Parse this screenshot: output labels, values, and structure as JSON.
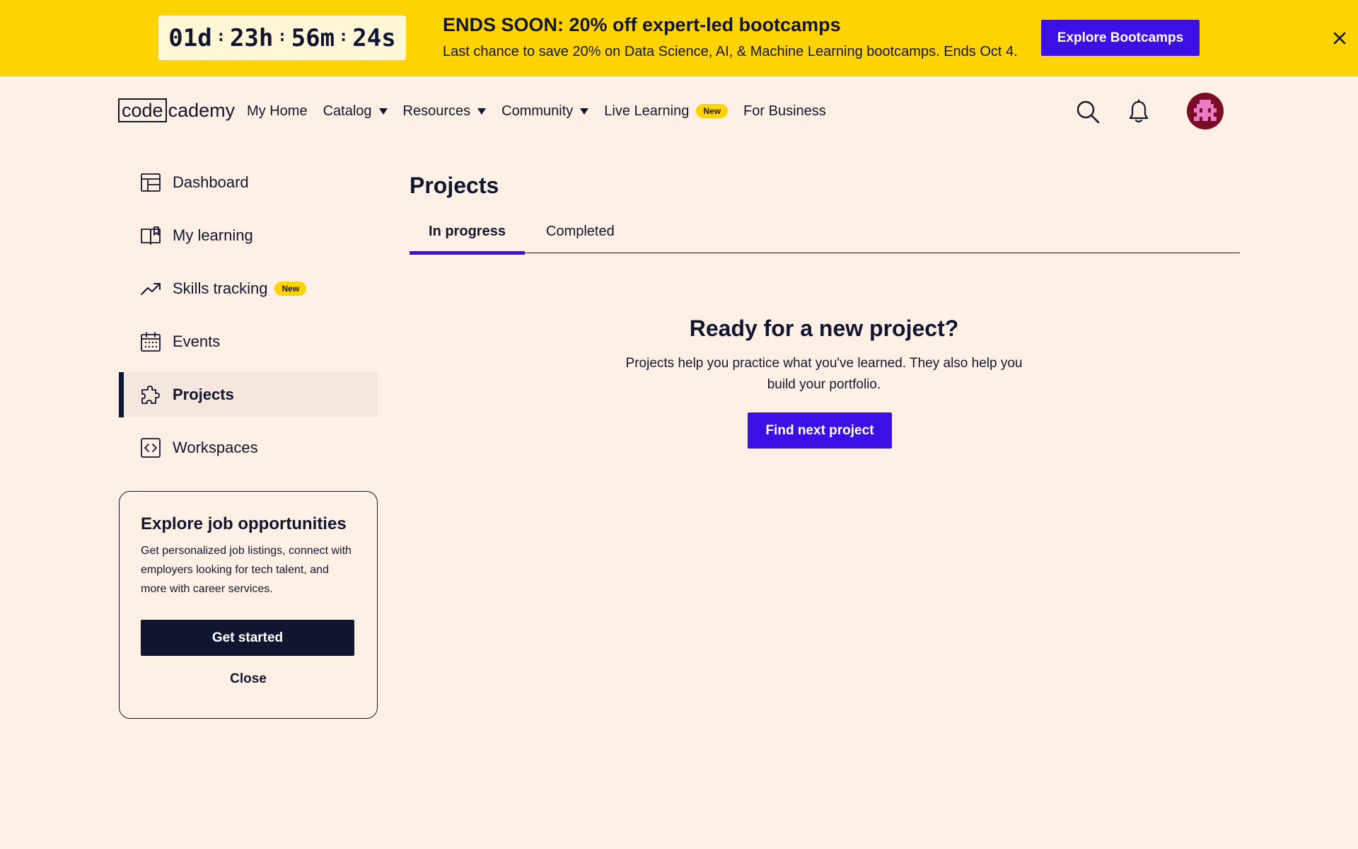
{
  "banner": {
    "countdown": {
      "days": "01d",
      "hours": "23h",
      "minutes": "56m",
      "seconds": "24s",
      "separator": ":"
    },
    "title": "ENDS SOON: 20% off expert-led bootcamps",
    "subtitle": "Last chance to save 20% on Data Science, AI, & Machine Learning bootcamps. Ends Oct 4.",
    "cta_label": "Explore Bootcamps",
    "close_icon": "close-icon"
  },
  "header": {
    "logo_boxed": "code",
    "logo_rest": "cademy",
    "nav": [
      {
        "label": "My Home",
        "has_caret": false
      },
      {
        "label": "Catalog",
        "has_caret": true
      },
      {
        "label": "Resources",
        "has_caret": true
      },
      {
        "label": "Community",
        "has_caret": true
      },
      {
        "label": "Live Learning",
        "badge": "New"
      },
      {
        "label": "For Business",
        "has_caret": false
      }
    ],
    "icons": [
      "search-icon",
      "bell-icon"
    ]
  },
  "sidebar": {
    "items": [
      {
        "label": "Dashboard",
        "icon": "dashboard-icon"
      },
      {
        "label": "My learning",
        "icon": "book-icon"
      },
      {
        "label": "Skills tracking",
        "icon": "trending-up-icon",
        "badge": "New"
      },
      {
        "label": "Events",
        "icon": "calendar-icon"
      },
      {
        "label": "Projects",
        "icon": "puzzle-icon",
        "active": true
      },
      {
        "label": "Workspaces",
        "icon": "code-icon"
      }
    ],
    "job_card": {
      "title": "Explore job opportunities",
      "body": "Get personalized job listings, connect with employers looking for tech talent, and more with career services.",
      "cta_label": "Get started",
      "close_label": "Close"
    }
  },
  "main": {
    "title": "Projects",
    "tabs": [
      {
        "label": "In progress",
        "active": true
      },
      {
        "label": "Completed",
        "active": false
      }
    ],
    "empty_state": {
      "title": "Ready for a new project?",
      "body": "Projects help you practice what you've learned. They also help you build your portfolio.",
      "cta_label": "Find next project"
    }
  },
  "colors": {
    "banner_bg": "#ffd300",
    "page_bg": "#fff0e5",
    "primary": "#3a10e5",
    "navy": "#10162f",
    "avatar_bg": "#7a0c28"
  }
}
